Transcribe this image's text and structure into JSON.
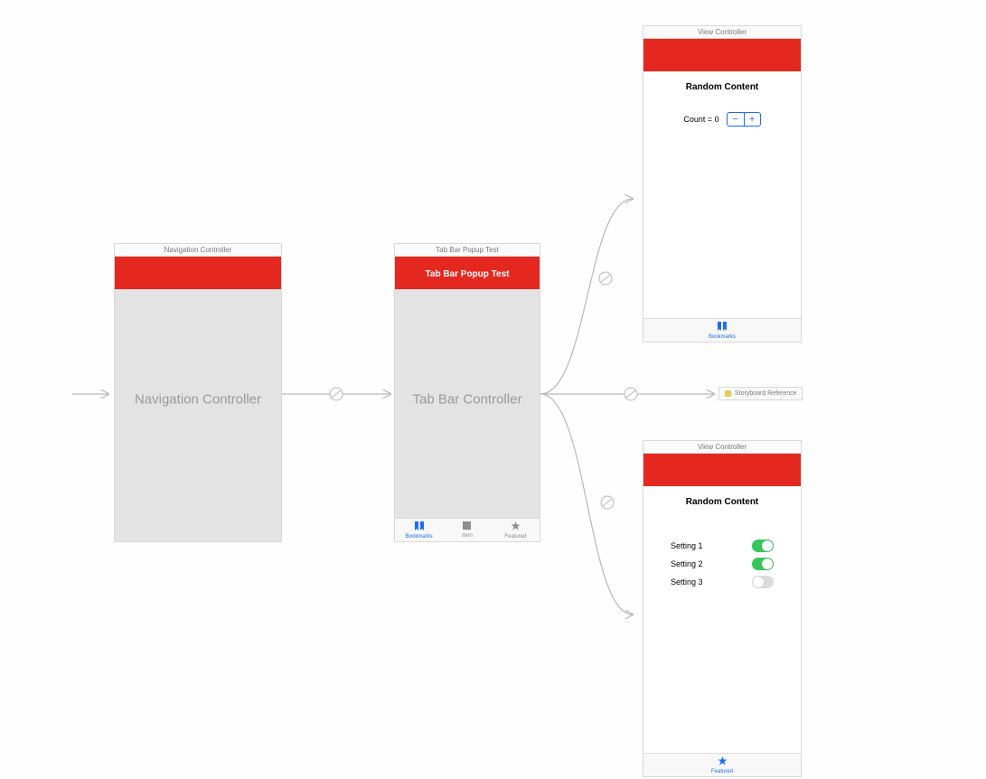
{
  "scene1": {
    "title": "Navigation Controller",
    "placeholder": "Navigation Controller"
  },
  "scene2": {
    "title": "Tab Bar Popup Test",
    "navtitle": "Tab Bar Popup Test",
    "placeholder": "Tab Bar Controller",
    "tabs": [
      {
        "label": "Bookmarks",
        "icon": "bookmarks"
      },
      {
        "label": "Item",
        "icon": "square"
      },
      {
        "label": "Featured",
        "icon": "star"
      }
    ]
  },
  "scene3": {
    "title": "View Controller",
    "heading": "Random Content",
    "count_label": "Count = 0",
    "tab": {
      "label": "Bookmarks",
      "icon": "bookmarks"
    }
  },
  "storyboard_ref": {
    "label": "Storyboard Reference"
  },
  "scene4": {
    "title": "View Controller",
    "heading": "Random Content",
    "settings": [
      {
        "label": "Setting 1",
        "on": true
      },
      {
        "label": "Setting 2",
        "on": true
      },
      {
        "label": "Setting 3",
        "on": false
      }
    ],
    "tab": {
      "label": "Featured",
      "icon": "star"
    }
  },
  "colors": {
    "red": "#e4281f",
    "blue": "#1a6df6",
    "green": "#35c759"
  }
}
